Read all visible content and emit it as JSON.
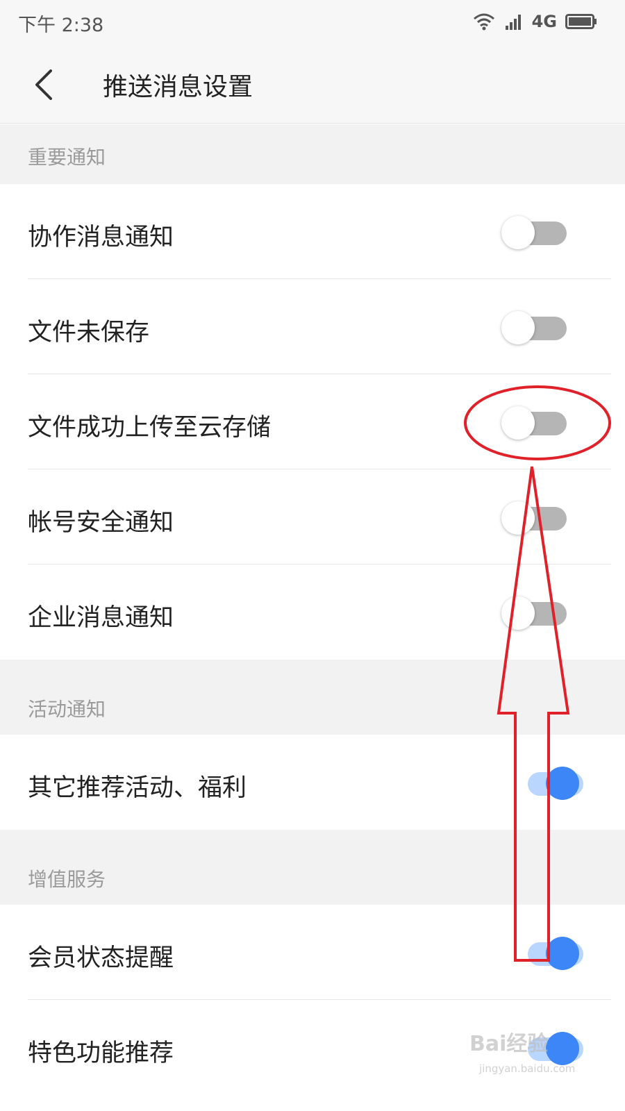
{
  "status_bar": {
    "time": "下午 2:38",
    "network": "4G",
    "icons": [
      "wifi-icon",
      "signal-icon",
      "battery-icon"
    ]
  },
  "header": {
    "back_icon": "back-arrow-icon",
    "title": "推送消息设置"
  },
  "sections": [
    {
      "title": "重要通知",
      "items": [
        {
          "label": "协作消息通知",
          "enabled": false
        },
        {
          "label": "文件未保存",
          "enabled": false
        },
        {
          "label": "文件成功上传至云存储",
          "enabled": false
        },
        {
          "label": "帐号安全通知",
          "enabled": false
        },
        {
          "label": "企业消息通知",
          "enabled": false
        }
      ]
    },
    {
      "title": "活动通知",
      "items": [
        {
          "label": "其它推荐活动、福利",
          "enabled": true
        }
      ]
    },
    {
      "title": "增值服务",
      "items": [
        {
          "label": "会员状态提醒",
          "enabled": true
        },
        {
          "label": "特色功能推荐",
          "enabled": true
        }
      ]
    }
  ],
  "colors": {
    "toggle_on_knob": "#3d86f7",
    "toggle_on_track": "#b8d6ff",
    "toggle_off_track": "#b5b5b5",
    "annotation": "#e0212a"
  },
  "watermark": {
    "brand": "Bai经验",
    "url": "jingyan.baidu.com"
  }
}
